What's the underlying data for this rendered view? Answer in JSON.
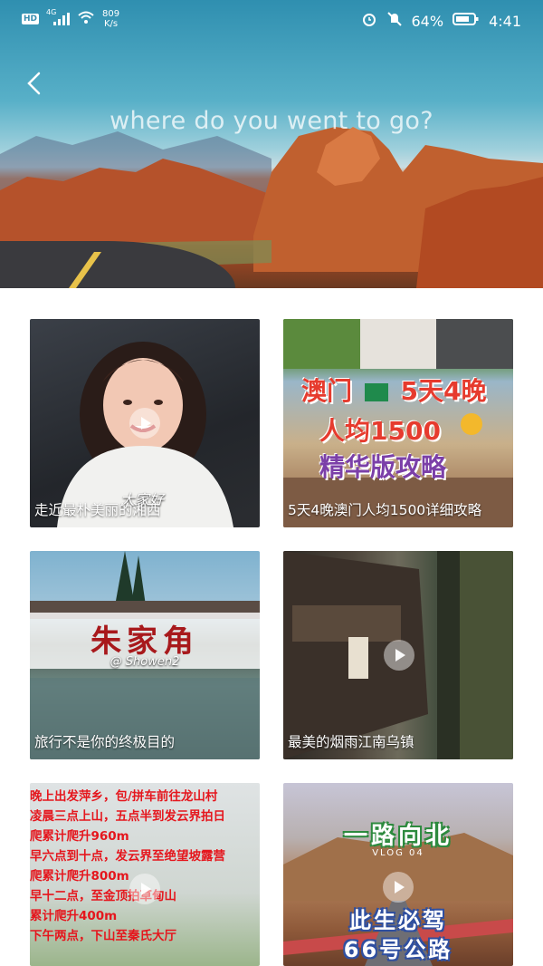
{
  "status_bar": {
    "left_badge": "HD",
    "signal": "4G",
    "net_speed_value": "809",
    "net_speed_unit": "K/s",
    "battery": "64%",
    "time": "4:41"
  },
  "hero": {
    "title": "where do you went to go?"
  },
  "cards": [
    {
      "caption": "走近最朴美丽的湘西",
      "overlay": "大家好"
    },
    {
      "caption": "5天4晚澳门人均1500详细攻略",
      "line1": "澳门",
      "line1b": "5天4晚",
      "line2": "人均1500",
      "line3": "精华版攻略"
    },
    {
      "caption": "旅行不是你的终极目的",
      "title": "朱家角",
      "subtitle": "@ Showen2"
    },
    {
      "caption": "最美的烟雨江南乌镇"
    },
    {
      "lines": [
        "晚上出发萍乡，包/拼车前往龙山村",
        "凌晨三点上山，五点半到发云界拍日",
        "爬累计爬升960m",
        "早六点到十点，发云界至绝望坡露营",
        "爬累计爬升800m",
        "早十二点，至金顶拍草甸山",
        "累计爬升400m",
        "下午两点，下山至秦氏大厅"
      ]
    },
    {
      "title": "一路向北",
      "subtitle": "VLOG 04",
      "line1": "此生必驾",
      "line2": "66号公路"
    }
  ]
}
